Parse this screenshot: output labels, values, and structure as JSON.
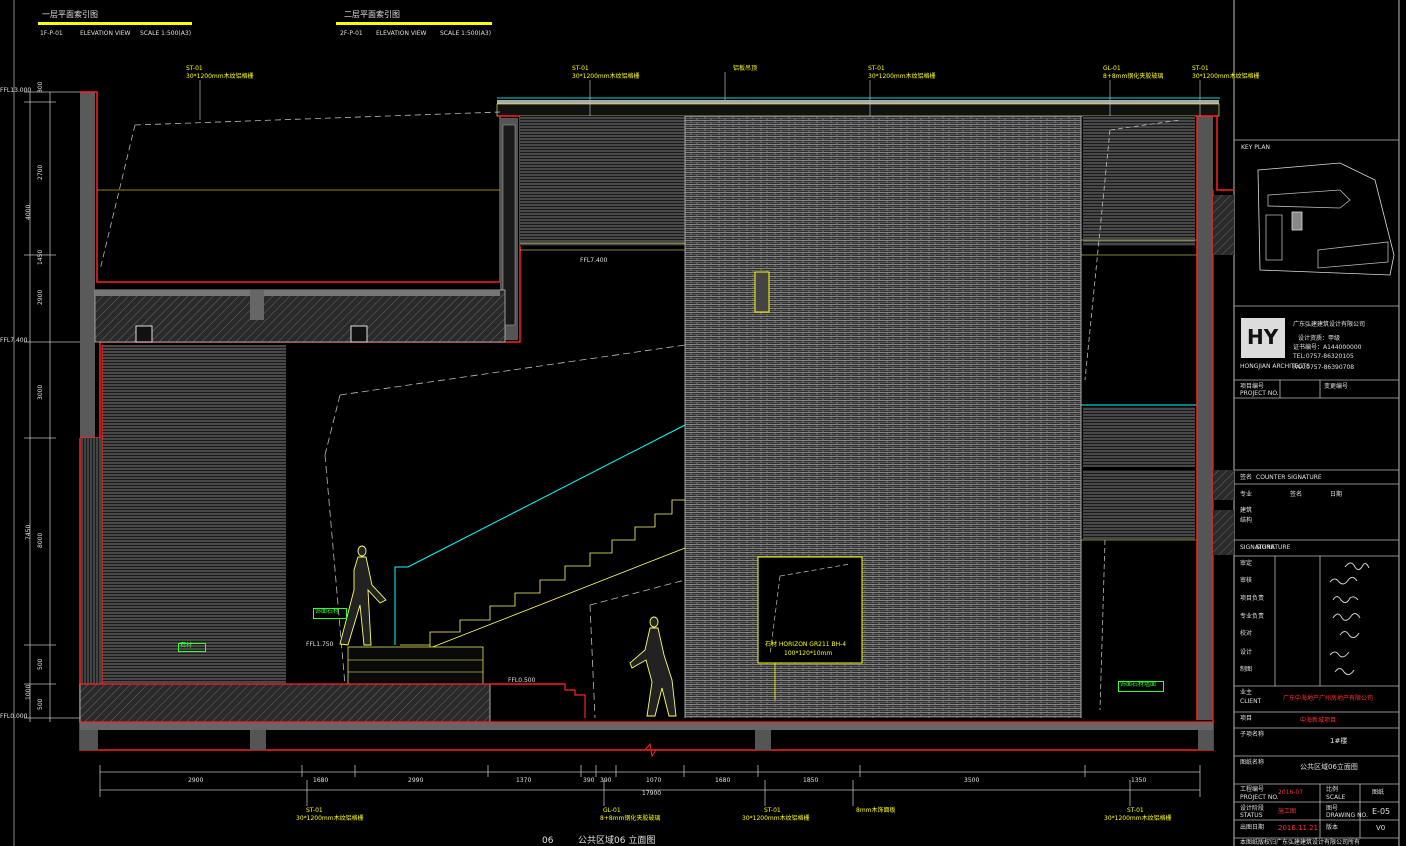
{
  "header": {
    "left_title": "一层平面索引图",
    "left_sub1": "1F-P-01",
    "left_sub2": "ELEVATION VIEW",
    "left_sub3": "SCALE 1:500(A3)",
    "right_title": "二层平面索引图",
    "right_sub1": "2F-P-01",
    "right_sub2": "ELEVATION VIEW",
    "right_sub3": "SCALE 1:500(A3)"
  },
  "top_notes": {
    "n1_tag": "ST-01",
    "n1": "30*1200mm木纹铝格栅",
    "n2_tag": "ST-01",
    "n2": "30*1200mm木纹铝格栅",
    "n3": "铝板吊顶",
    "n4_tag": "ST-01",
    "n4": "30*1200mm木纹铝格栅",
    "n5_tag": "GL-01",
    "n5": "8+8mm钢化夹胶玻璃",
    "n6_tag": "ST-01",
    "n6": "30*1200mm木纹铝格栅"
  },
  "levels": {
    "l1": "FFL13.000",
    "l2": "FFL7.400",
    "l3": "FFL0.000",
    "l4": "FFL7.400",
    "l5": "FFL1.750",
    "l6": "FFL0.500"
  },
  "left_dims": [
    "300",
    "2700",
    "4000",
    "1450",
    "2900",
    "7450",
    "3000",
    "8000",
    "500",
    "1000",
    "500"
  ],
  "bottom_dims": [
    "2900",
    "1680",
    "2990",
    "1370",
    "390",
    "390",
    "1070",
    "1680",
    "1850",
    "3500",
    "1350"
  ],
  "bottom_total": "17900",
  "bottom_notes": {
    "b1_tag": "ST-01",
    "b1": "30*1200mm木纹铝格栅",
    "b2_tag": "GL-01",
    "b2": "8+8mm钢化夹胶玻璃",
    "b3_tag": "ST-01",
    "b3": "30*1200mm木纹铝格栅",
    "b4": "8mm木饰面板",
    "b5_tag": "ST-01",
    "b5": "30*1200mm木纹铝格栅"
  },
  "wall_labels": {
    "stone": "石材 HORIZON  GR211  BH-4",
    "stone_sub": "100*120*10mm",
    "green1": "饰面石材",
    "green2": "石材",
    "green3": "饰面石材墙面"
  },
  "drawing_title": {
    "number": "06",
    "title": "公共区域06 立面图"
  },
  "titleblock": {
    "key_plan": "KEY PLAN",
    "company_cn": "广东弘建建筑设计有限公司",
    "company_line2": "设计资质：甲级",
    "company_line3": "证书编号：A144000000",
    "tel": "TEL:0757-86320105",
    "fax": "FAX:0757-86390708",
    "logo_sub": "HONGJIAN ARCHITECTS",
    "row_project_no": "项目编号",
    "row_project_no_en": "PROJECT NO.",
    "row_change": "变更编号",
    "counter_signature": "COUNTER SIGNATURE",
    "sig_label": "签名",
    "sig_label_en": "SIGNATURE",
    "role_major": "专业",
    "role_sign": "签名",
    "role_date": "日期",
    "role_arch": "建筑",
    "role_struct": "结构",
    "signature_title": "SIGNATURE",
    "roles": [
      "审定",
      "审核",
      "项目负责",
      "专业负责",
      "校对",
      "设计",
      "制图"
    ],
    "client_label": "业主",
    "client_label_en": "CLIENT",
    "client": "广东中海地产广州房地产有限公司",
    "project_label": "项目",
    "project": "中海新城项目",
    "area_label": "子项名称",
    "area": "1#楼",
    "drawing_label": "图纸名称",
    "drawing_name": "公共区域06立面图",
    "job_label": "工程编号",
    "job_label_en": "PROJECT NO.",
    "job_value": "2016-07",
    "phase_label": "设计阶段",
    "phase_en": "STATUS",
    "phase_value": "施工图",
    "date_label": "出图日期",
    "date_value": "2016.11.21",
    "scale_label": "比例",
    "scale_en": "SCALE",
    "drawing_no_label": "图号",
    "drawing_no_en": "DRAWING NO.",
    "drawing_no": "E-05",
    "sheet_label": "图纸",
    "version_label": "版本",
    "version": "V0",
    "footer": "本图纸版权归广东弘建建筑设计有限公司所有"
  },
  "colors": {
    "bg": "#000000",
    "red_line": "#ff2020",
    "yellow": "#ffff00",
    "cyan": "#00ffff",
    "green": "#30ff30",
    "grey_fill": "#555555",
    "hatch": "#8a8a8a"
  }
}
